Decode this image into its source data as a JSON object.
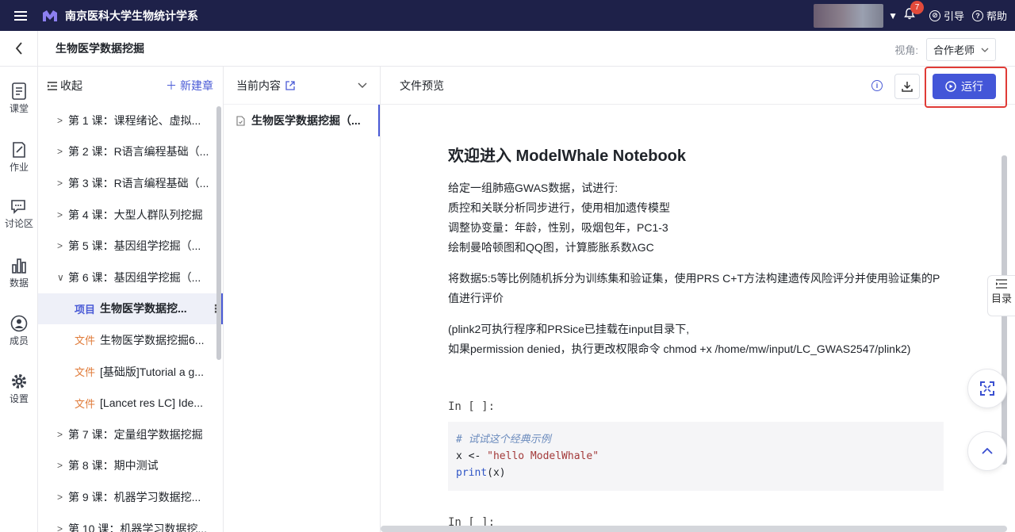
{
  "topbar": {
    "org_name": "南京医科大学生物统计学系",
    "notification_count": "7",
    "guide_label": "引导",
    "help_label": "帮助"
  },
  "subbar": {
    "title": "生物医学数据挖掘",
    "view_label": "视角:",
    "view_value": "合作老师"
  },
  "rail": [
    {
      "label": "课堂",
      "icon": "classroom-icon"
    },
    {
      "label": "作业",
      "icon": "homework-icon"
    },
    {
      "label": "讨论区",
      "icon": "discussion-icon"
    },
    {
      "label": "数据",
      "icon": "data-icon"
    },
    {
      "label": "成员",
      "icon": "members-icon"
    },
    {
      "label": "设置",
      "icon": "settings-icon"
    }
  ],
  "chapters": {
    "collapse_label": "收起",
    "new_chapter_label": "新建章",
    "items": [
      {
        "text": "第 1 课：课程绪论、虚拟..."
      },
      {
        "text": "第 2 课：R语言编程基础（..."
      },
      {
        "text": "第 3 课：R语言编程基础（..."
      },
      {
        "text": "第 4 课：大型人群队列挖掘"
      },
      {
        "text": "第 5 课：基因组学挖掘（..."
      },
      {
        "text": "第 6 课：基因组学挖掘（..."
      },
      {
        "tag": "项目",
        "text": "生物医学数据挖..."
      },
      {
        "tag": "文件",
        "text": "生物医学数据挖掘6..."
      },
      {
        "tag": "文件",
        "text": "[基础版]Tutorial a g..."
      },
      {
        "tag": "文件",
        "text": "[Lancet res LC] Ide..."
      },
      {
        "text": "第 7 课：定量组学数据挖掘"
      },
      {
        "text": "第 8 课：期中测试"
      },
      {
        "text": "第 9 课：机器学习数据挖..."
      },
      {
        "text": "第 10 课：机器学习数据挖..."
      }
    ]
  },
  "current": {
    "header_label": "当前内容",
    "item_label": "生物医学数据挖掘（..."
  },
  "preview": {
    "header_label": "文件预览",
    "run_label": "运行",
    "doc_title": "欢迎进入 ModelWhale Notebook",
    "lines1": [
      "给定一组肺癌GWAS数据，试进行:",
      "质控和关联分析同步进行，使用相加遗传模型",
      "调整协变量：年龄，性别，吸烟包年，PC1-3",
      "绘制曼哈顿图和QQ图，计算膨胀系数λGC"
    ],
    "para2": "将数据5:5等比例随机拆分为训练集和验证集，使用PRS C+T方法构建遗传风险评分并使用验证集的P值进行评价",
    "lines3": [
      "(plink2可执行程序和PRSice已挂载在input目录下,",
      "如果permission denied，执行更改权限命令 chmod +x /home/mw/input/LC_GWAS2547/plink2)"
    ],
    "prompt1": "In [ ]:",
    "code_comment": "# 试试这个经典示例",
    "code_line2_pre": "x <- ",
    "code_line2_str": "\"hello ModelWhale\"",
    "code_line3_fn": "print",
    "code_line3_rest": "(x)",
    "prompt2": "In [ ]:",
    "toc_label": "目录"
  }
}
